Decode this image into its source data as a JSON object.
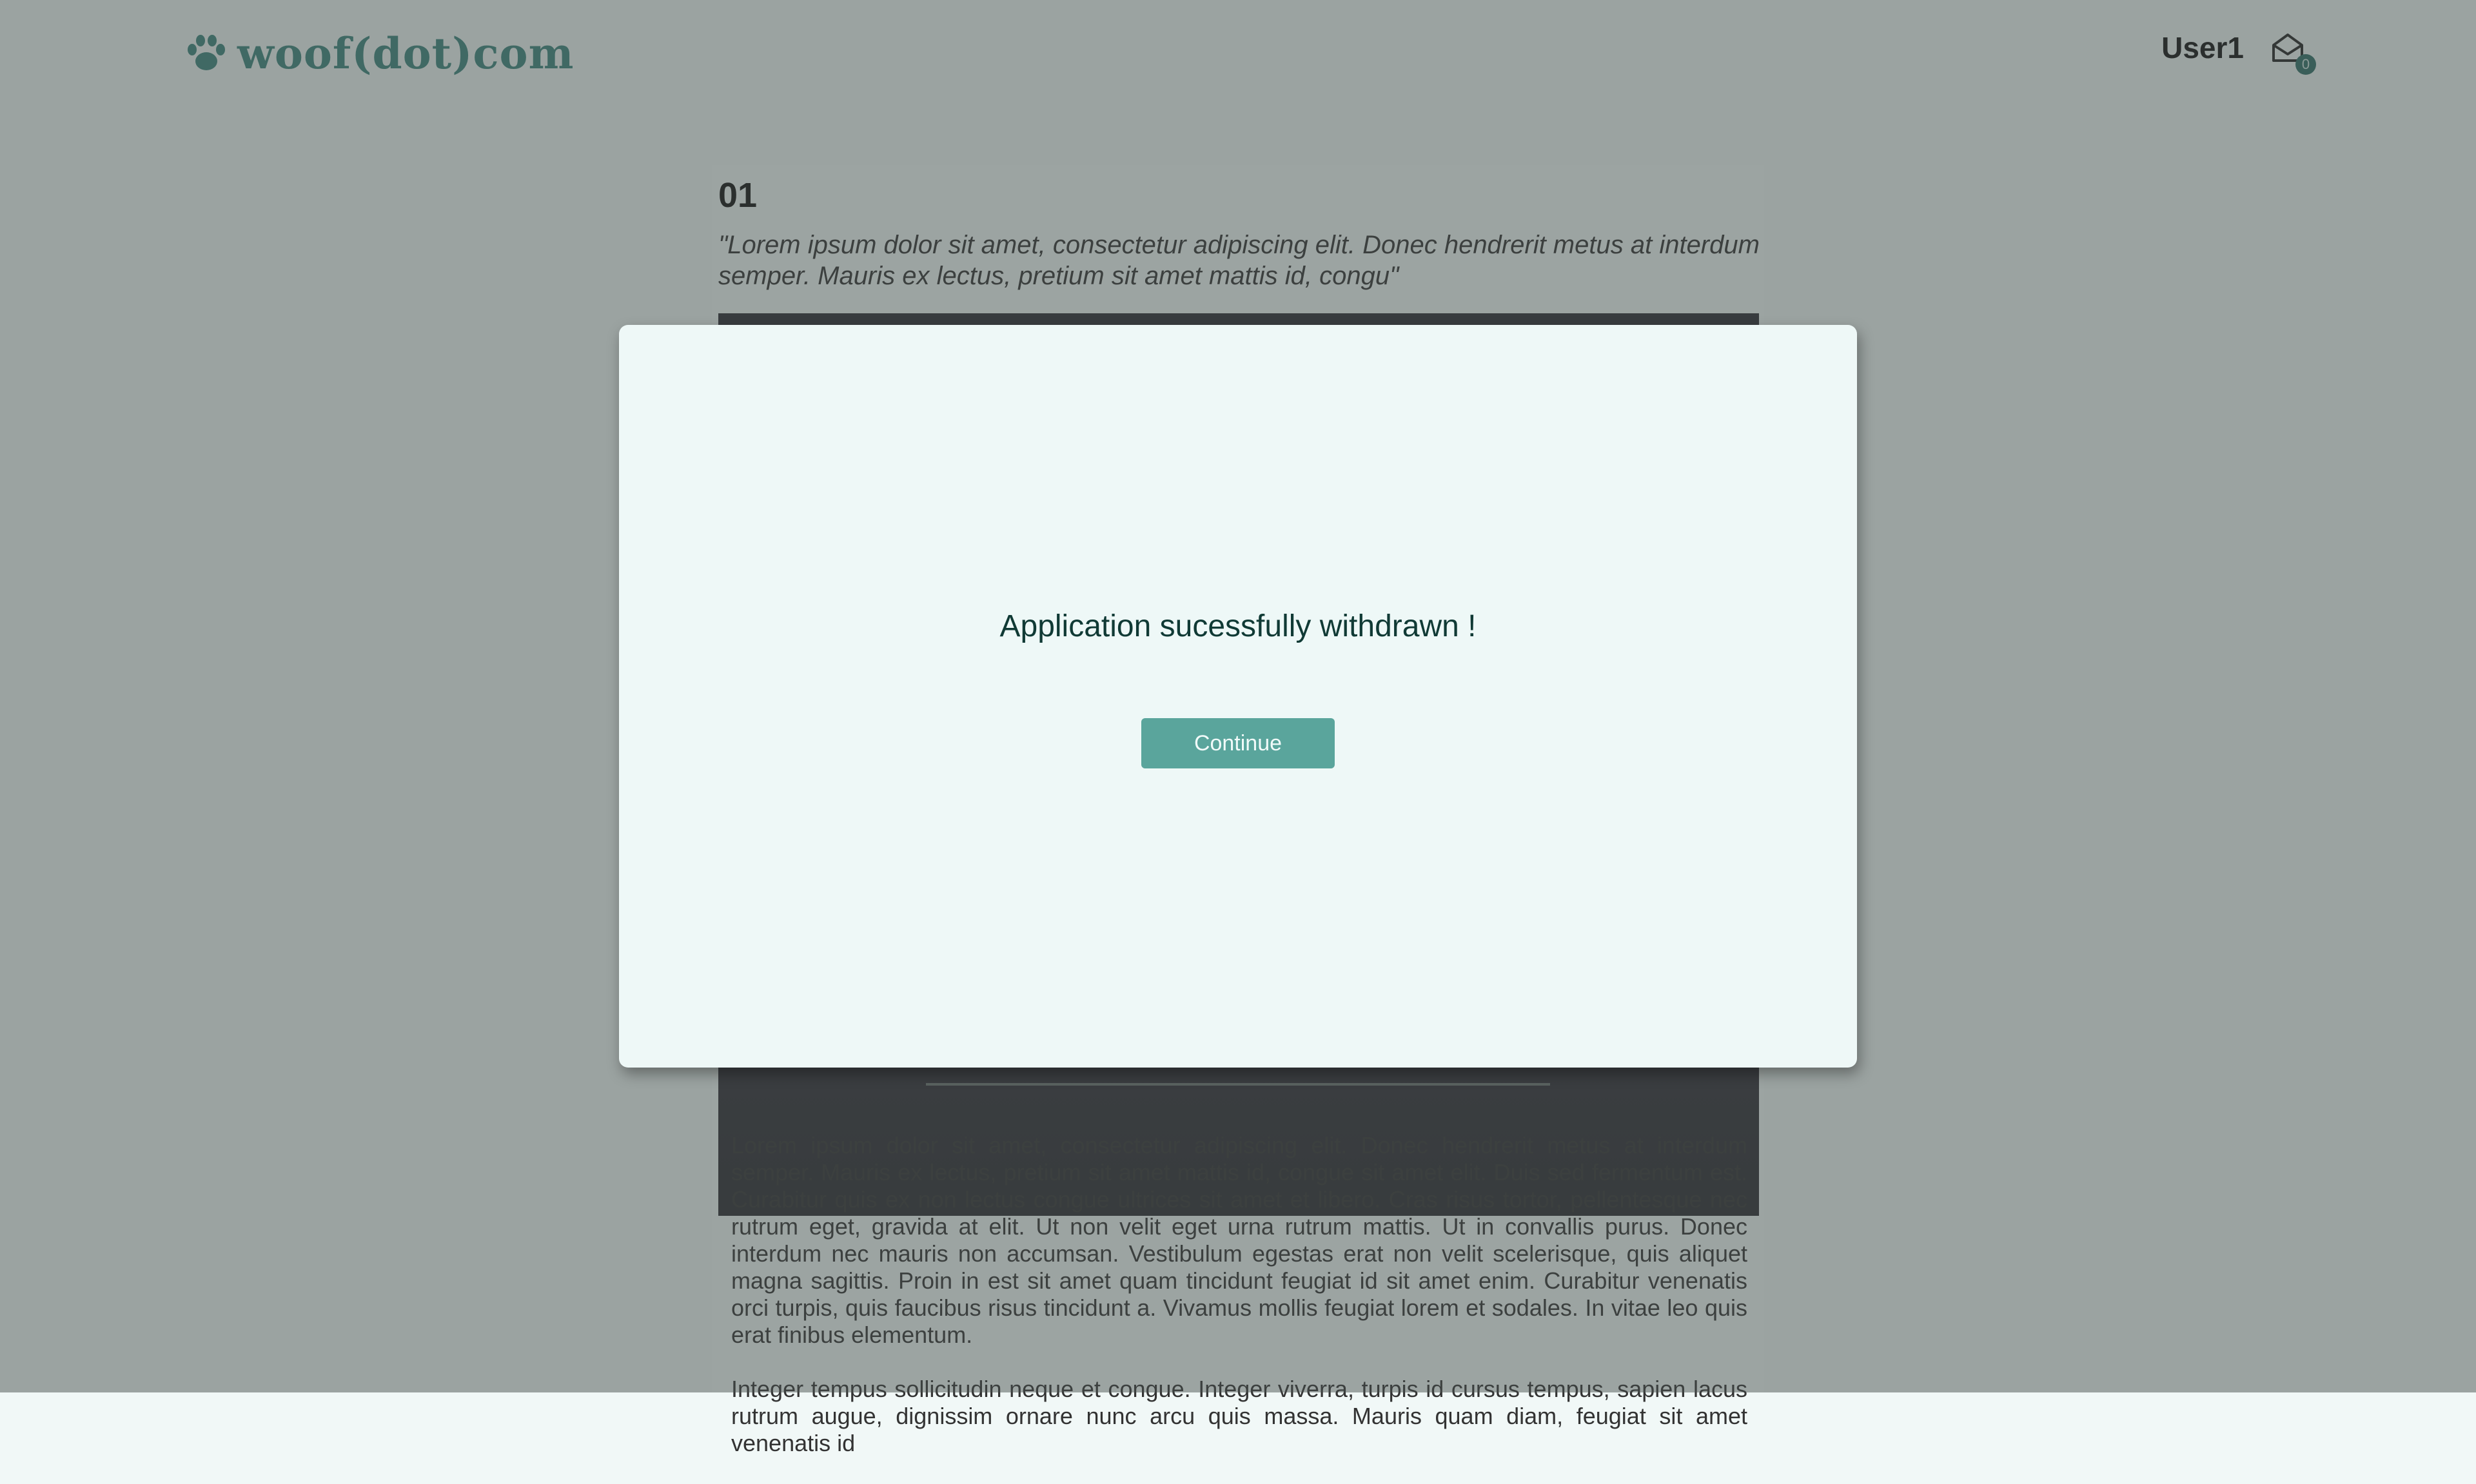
{
  "header": {
    "logo_text": "woof(dot)com",
    "logo_icon": "paw-icon",
    "username": "User1",
    "mail_icon": "envelope-open-icon",
    "mail_count": "0"
  },
  "card": {
    "number": "01",
    "quote": "\"Lorem ipsum dolor sit amet, consectetur adipiscing elit. Donec hendrerit metus at interdum semper. Mauris ex lectus, pretium sit amet mattis id, congu\"",
    "paragraphs": [
      "Lorem ipsum dolor sit amet, consectetur adipiscing elit. Donec hendrerit metus at interdum semper. Mauris ex lectus, pretium sit amet mattis id, congue sit amet elit. Duis sed fermentum est. Curabitur quis ex non lectus congue ultrices sit amet et libero. Cras risus tortor, pellentesque nec rutrum eget, gravida at elit. Ut non velit eget urna rutrum mattis. Ut in convallis purus. Donec interdum nec mauris non accumsan. Vestibulum egestas erat non velit scelerisque, quis aliquet magna sagittis. Proin in est sit amet quam tincidunt feugiat id sit amet enim. Curabitur venenatis orci turpis, quis faucibus risus tincidunt a. Vivamus mollis feugiat lorem et sodales. In vitae leo quis erat finibus elementum.",
      "Integer tempus sollicitudin neque et congue. Integer viverra, turpis id cursus tempus, sapien lacus rutrum augue, dignissim ornare nunc arcu quis massa. Mauris quam diam, feugiat sit amet venenatis id"
    ]
  },
  "modal": {
    "message": "Application sucessfully withdrawn !",
    "continue_label": "Continue"
  },
  "colors": {
    "accent": "#5aa59c",
    "logo": "#3b857c",
    "badge": "#2f6e66",
    "overlay": "rgba(70,78,76,0.5)",
    "modal_bg": "#eef8f7"
  }
}
